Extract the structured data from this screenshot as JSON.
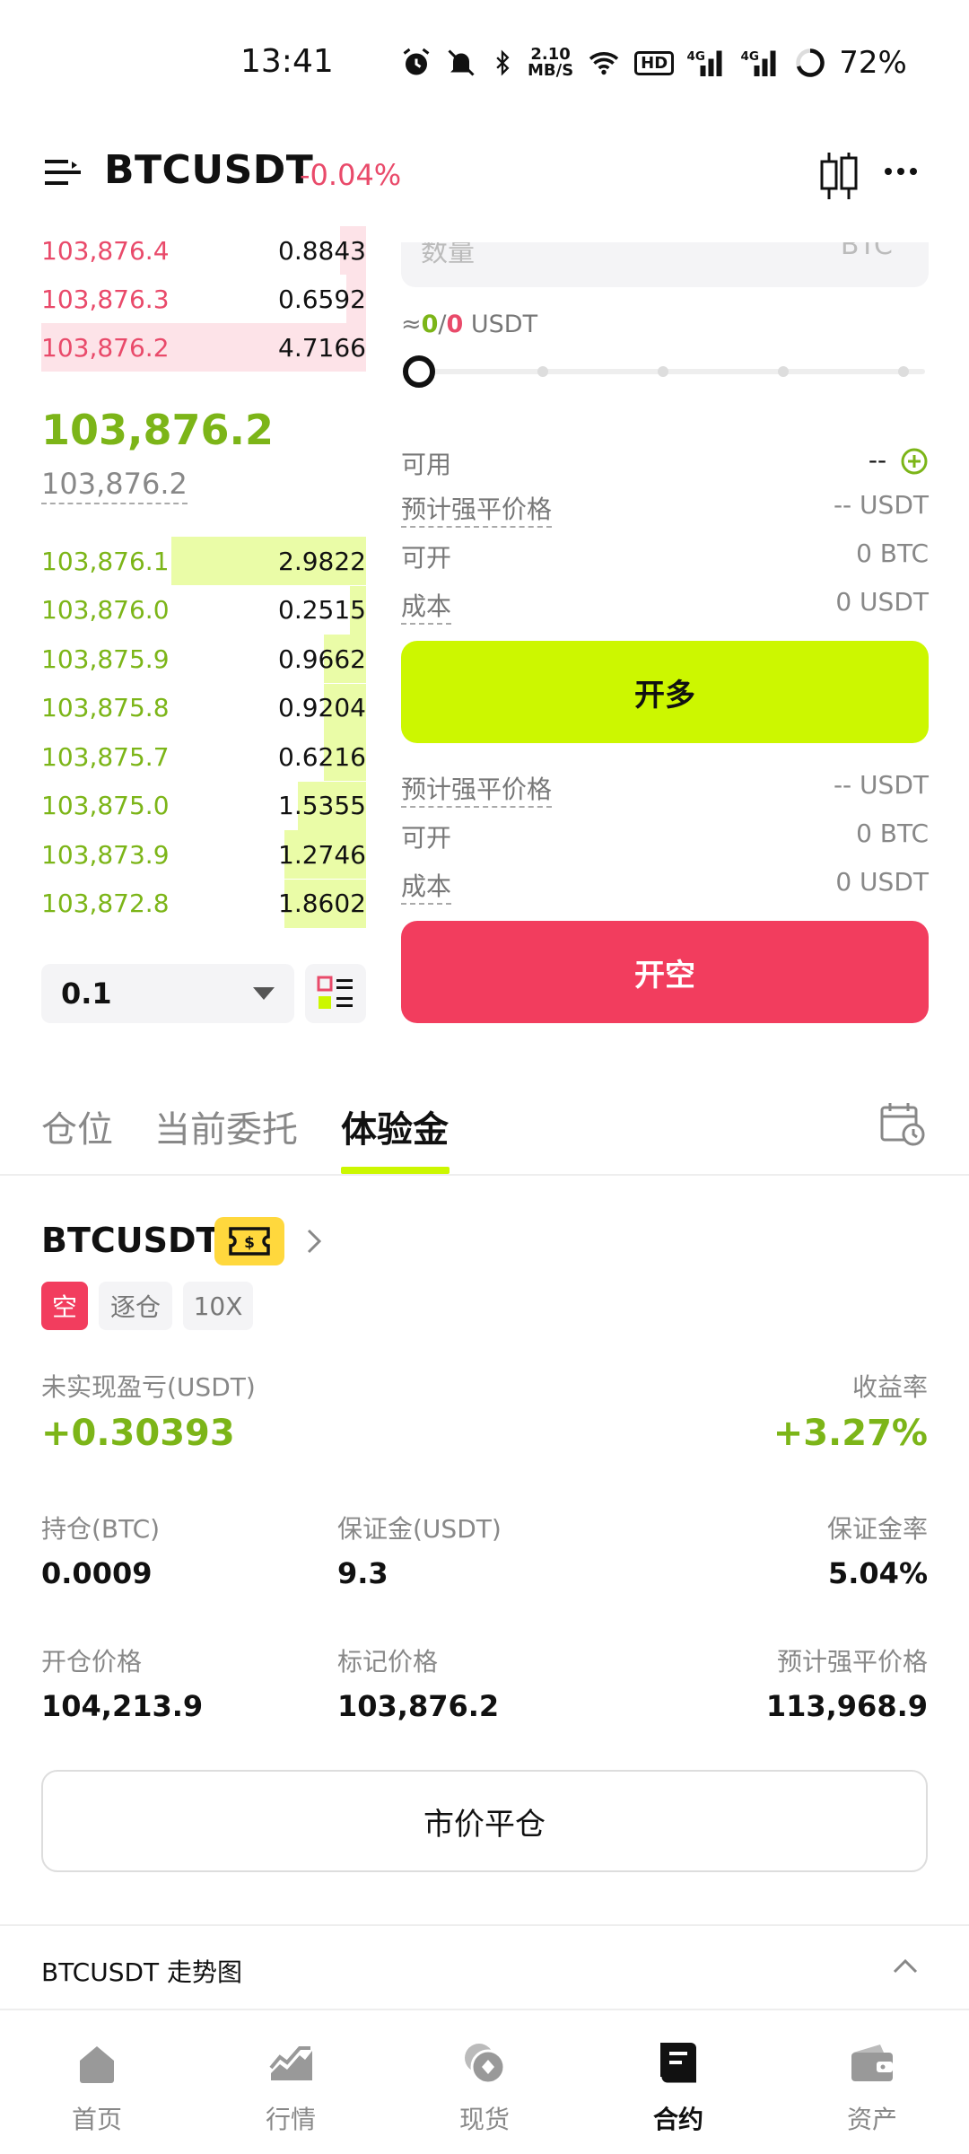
{
  "status_bar": {
    "time": "13:41",
    "net_speed_value": "2.10",
    "net_speed_unit": "MB/S",
    "hd_label": "HD",
    "battery": "72%"
  },
  "header": {
    "symbol": "BTCUSDT",
    "change": "-0.04%"
  },
  "order_book": {
    "asks": [
      {
        "price": "103,876.4",
        "qty": "0.8843",
        "depth": 0.08
      },
      {
        "price": "103,876.3",
        "qty": "0.6592",
        "depth": 0.06
      },
      {
        "price": "103,876.2",
        "qty": "4.7166",
        "depth": 1.0
      }
    ],
    "last_price": "103,876.2",
    "mark_price": "103,876.2",
    "bids": [
      {
        "price": "103,876.1",
        "qty": "2.9822",
        "depth": 0.6
      },
      {
        "price": "103,876.0",
        "qty": "0.2515",
        "depth": 0.05
      },
      {
        "price": "103,875.9",
        "qty": "0.9662",
        "depth": 0.13
      },
      {
        "price": "103,875.8",
        "qty": "0.9204",
        "depth": 0.13
      },
      {
        "price": "103,875.7",
        "qty": "0.6216",
        "depth": 0.13
      },
      {
        "price": "103,875.0",
        "qty": "1.5355",
        "depth": 0.21
      },
      {
        "price": "103,873.9",
        "qty": "1.2746",
        "depth": 0.25
      },
      {
        "price": "103,872.8",
        "qty": "1.8602",
        "depth": 0.25
      }
    ],
    "precision": "0.1"
  },
  "order_form": {
    "qty_placeholder": "数量",
    "qty_unit": "BTC",
    "approx_prefix": "≈",
    "approx_green": "0",
    "approx_sep": "/",
    "approx_red": "0",
    "approx_unit": " USDT",
    "available_label": "可用",
    "available_value": "--",
    "long": {
      "liq_label": "预计强平价格",
      "liq_value": "-- USDT",
      "open_label": "可开",
      "open_value": "0 BTC",
      "cost_label": "成本",
      "cost_value": "0 USDT",
      "button": "开多"
    },
    "short": {
      "liq_label": "预计强平价格",
      "liq_value": "-- USDT",
      "open_label": "可开",
      "open_value": "0 BTC",
      "cost_label": "成本",
      "cost_value": "0 USDT",
      "button": "开空"
    }
  },
  "tabs": [
    {
      "label": "仓位"
    },
    {
      "label": "当前委托"
    },
    {
      "label": "体验金"
    }
  ],
  "position": {
    "symbol": "BTCUSDT",
    "side_tag": "空",
    "margin_mode": "逐仓",
    "leverage": "10X",
    "unrealized_label": "未实现盈亏(USDT)",
    "unrealized_value": "+0.30393",
    "roi_label": "收益率",
    "roi_value": "+3.27%",
    "size_label": "持仓(BTC)",
    "size_value": "0.0009",
    "margin_label": "保证金(USDT)",
    "margin_value": "9.3",
    "margin_rate_label": "保证金率",
    "margin_rate_value": "5.04%",
    "entry_label": "开仓价格",
    "entry_value": "104,213.9",
    "mark_label": "标记价格",
    "mark_value": "103,876.2",
    "liq_label": "预计强平价格",
    "liq_value": "113,968.9",
    "close_button": "市价平仓"
  },
  "trend": {
    "title": "BTCUSDT 走势图"
  },
  "nav": [
    {
      "label": "首页"
    },
    {
      "label": "行情"
    },
    {
      "label": "现货"
    },
    {
      "label": "合约"
    },
    {
      "label": "资产"
    }
  ],
  "colors": {
    "green": "#7cb518",
    "red": "#e94a6a",
    "accent": "#ccf700",
    "short_button": "#f23d5e"
  }
}
